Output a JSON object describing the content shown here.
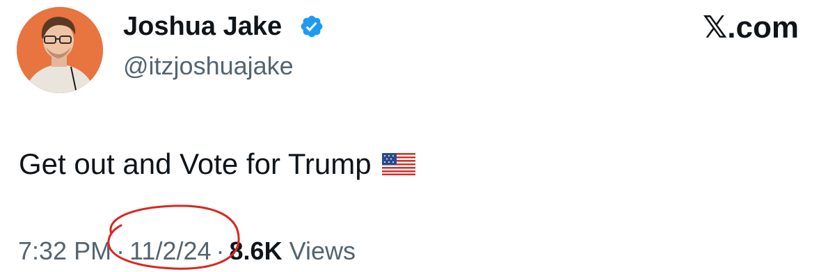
{
  "author": {
    "display_name": "Joshua Jake",
    "handle": "@itzjoshuajake",
    "verified": true,
    "avatar": "profile-photo"
  },
  "brand": "𝕏.com",
  "tweet": {
    "text": "Get out and Vote for Trump",
    "emoji": "us-flag"
  },
  "meta": {
    "time": "7:32 PM",
    "separator": "·",
    "date": "11/2/24",
    "views_count": "8.6K",
    "views_label": "Views"
  },
  "annotation": {
    "type": "hand-drawn circle around date",
    "color": "#d7281e"
  },
  "colors": {
    "verified_badge": "#1d9bf0",
    "secondary_text": "#536471",
    "primary_text": "#0f1419",
    "avatar_background": "#e8743f"
  }
}
